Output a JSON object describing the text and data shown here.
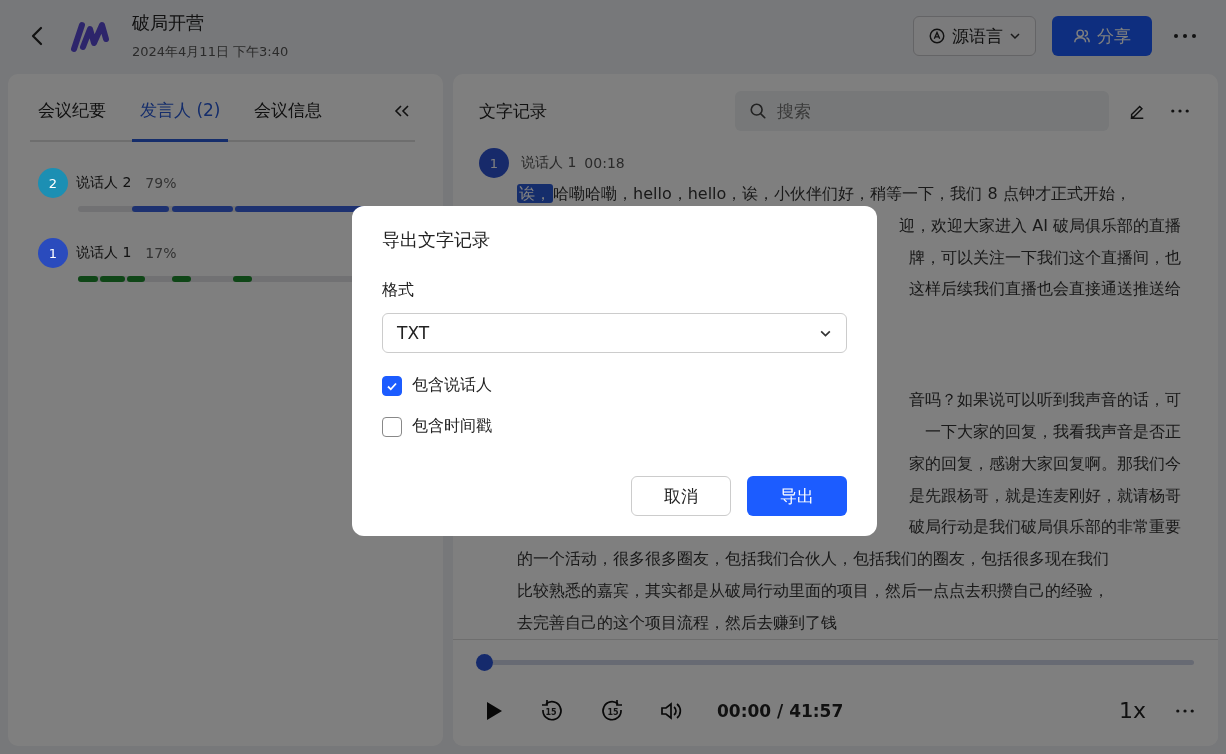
{
  "header": {
    "title": "破局开营",
    "date": "2024年4月11日 下午3:40",
    "language_button": "源语言",
    "share_button": "分享"
  },
  "left_panel": {
    "tabs": [
      {
        "label": "会议纪要",
        "selected": false
      },
      {
        "label": "发言人 (2)",
        "selected": true
      },
      {
        "label": "会议信息",
        "selected": false
      }
    ],
    "speakers": [
      {
        "number": "2",
        "name": "说话人 2",
        "share": "79%",
        "color": "#1c8fb3"
      },
      {
        "number": "1",
        "name": "说话人 1",
        "share": "17%",
        "color": "#2a4bbd"
      }
    ]
  },
  "transcript": {
    "title": "文字记录",
    "search": {
      "placeholder": "搜索"
    },
    "speaker": {
      "number": "1",
      "name": "说话人 1",
      "time": "00:18"
    },
    "paragraphs": [
      {
        "highlight": "诶，",
        "lines": [
          "哈嘞哈嘞，hello，hello，诶，小伙伴们好，稍等一下，我们 8 点钟才正式开始，",
          "迎，欢迎大家进入 AI 破局俱乐部的直播",
          "牌，可以关注一下我们这个直播间，也",
          "这样后续我们直播也会直接通送推送给"
        ]
      },
      {
        "lines": [
          "音吗？如果说可以听到我声音的话，可",
          "一下大家的回复，我看我声音是否正",
          "家的回复，感谢大家回复啊。那我们今",
          "是先跟杨哥，就是连麦刚好，就请杨哥",
          "破局行动是我们破局俱乐部的非常重要",
          "的一个活动，很多很多圈友，包括我们合伙人，包括我们的圈友，包括很多现在我们",
          "比较熟悉的嘉宾，其实都是从破局行动里面的项目，然后一点点去积攒自己的经验，",
          "去完善自己的这个项目流程，然后去赚到了钱"
        ]
      }
    ]
  },
  "player": {
    "rewind_label": "15",
    "forward_label": "15",
    "level": 0,
    "time": "00:00 / 41:57",
    "speed": "1x"
  },
  "dialog": {
    "title": "导出文字记录",
    "format_label": "格式",
    "format_value": "TXT",
    "options": [
      {
        "label": "包含说话人",
        "checked": true
      },
      {
        "label": "包含时间戳",
        "checked": false
      }
    ],
    "cancel_button": "取消",
    "export_button": "导出"
  }
}
